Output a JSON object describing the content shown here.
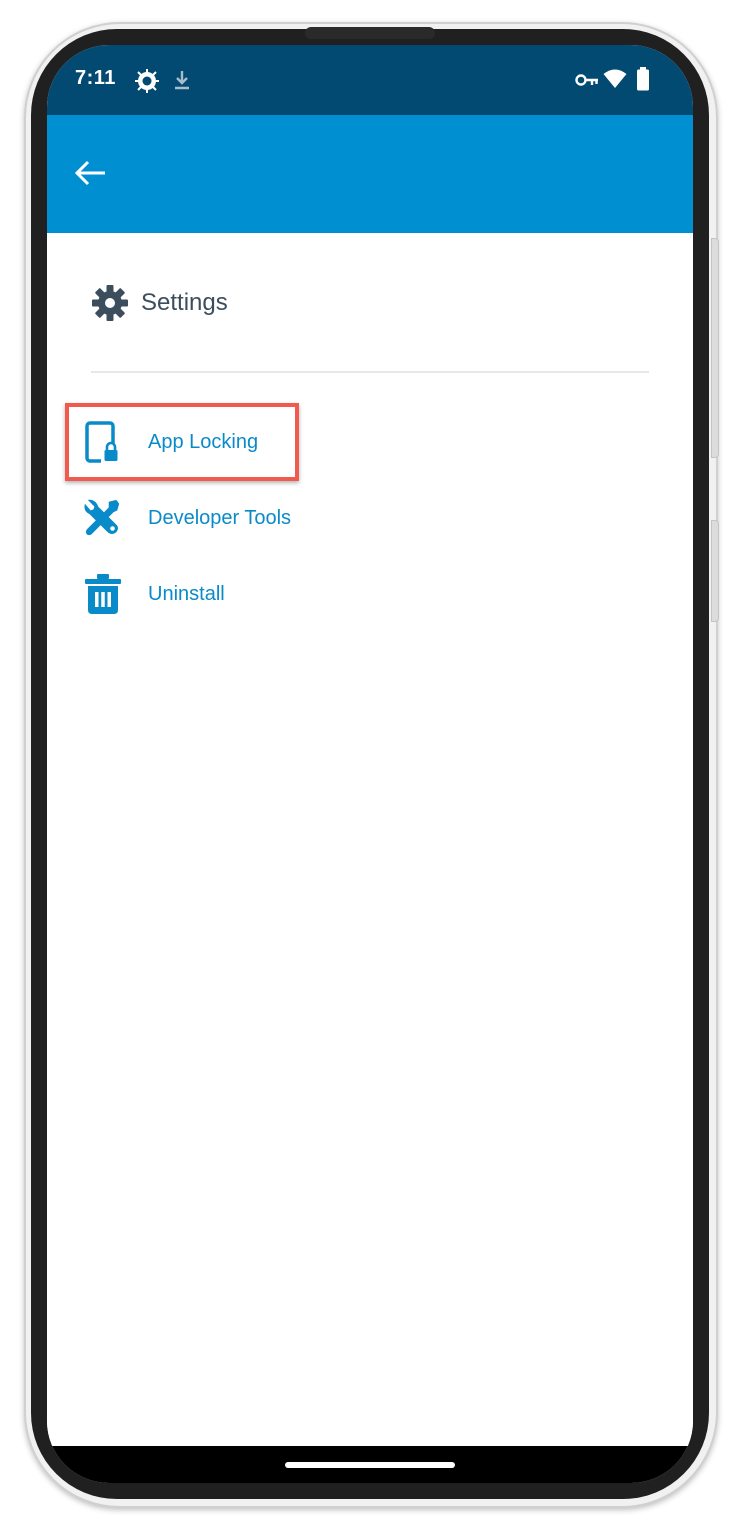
{
  "status_bar": {
    "time": "7:11",
    "left_icons": [
      "settings-badge-icon",
      "download-icon"
    ],
    "right_icons": [
      "vpn-key-icon",
      "wifi-icon",
      "battery-icon"
    ]
  },
  "app_bar": {
    "back_icon": "arrow-left-icon",
    "color": "#008fd0"
  },
  "settings": {
    "icon": "gear-icon",
    "title": "Settings"
  },
  "menu": {
    "items": [
      {
        "label": "App Locking",
        "icon": "device-lock-icon",
        "highlighted": true
      },
      {
        "label": "Developer Tools",
        "icon": "tools-icon",
        "highlighted": false
      },
      {
        "label": "Uninstall",
        "icon": "trash-icon",
        "highlighted": false
      }
    ]
  },
  "colors": {
    "status_bar": "#034a73",
    "accent": "#0a8bc9",
    "highlight": "#f15a4e",
    "title_text": "#3c4e5e"
  }
}
